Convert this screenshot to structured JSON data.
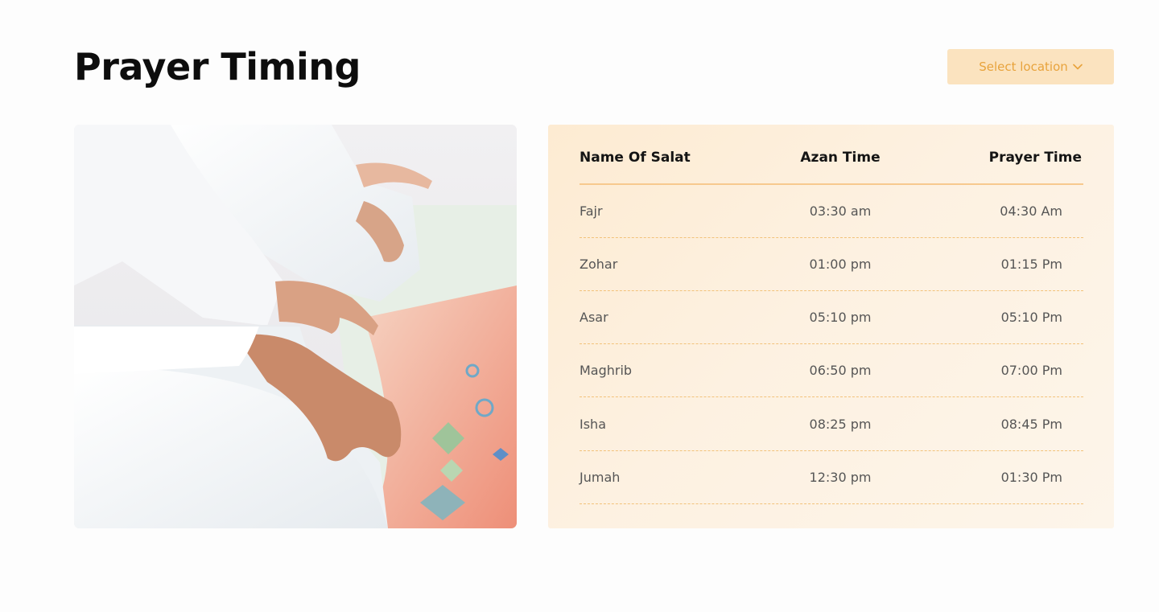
{
  "page": {
    "title": "Prayer Timing"
  },
  "location": {
    "label": "Select location",
    "icon": "chevron-down-icon",
    "accent_color": "#e8a33c",
    "background_color": "#fbe3bf"
  },
  "table": {
    "headers": {
      "name": "Name Of Salat",
      "azan": "Azan Time",
      "prayer": "Prayer Time"
    },
    "rows": [
      {
        "name": "Fajr",
        "azan": "03:30 am",
        "prayer": "04:30 Am"
      },
      {
        "name": "Zohar",
        "azan": "01:00 pm",
        "prayer": "01:15 Pm"
      },
      {
        "name": "Asar",
        "azan": "05:10 pm",
        "prayer": "05:10 Pm"
      },
      {
        "name": "Maghrib",
        "azan": "06:50 pm",
        "prayer": "07:00 Pm"
      },
      {
        "name": "Isha",
        "azan": "08:25 pm",
        "prayer": "08:45 Pm"
      },
      {
        "name": "Jumah",
        "azan": "12:30 pm",
        "prayer": "01:30 Pm"
      }
    ]
  }
}
